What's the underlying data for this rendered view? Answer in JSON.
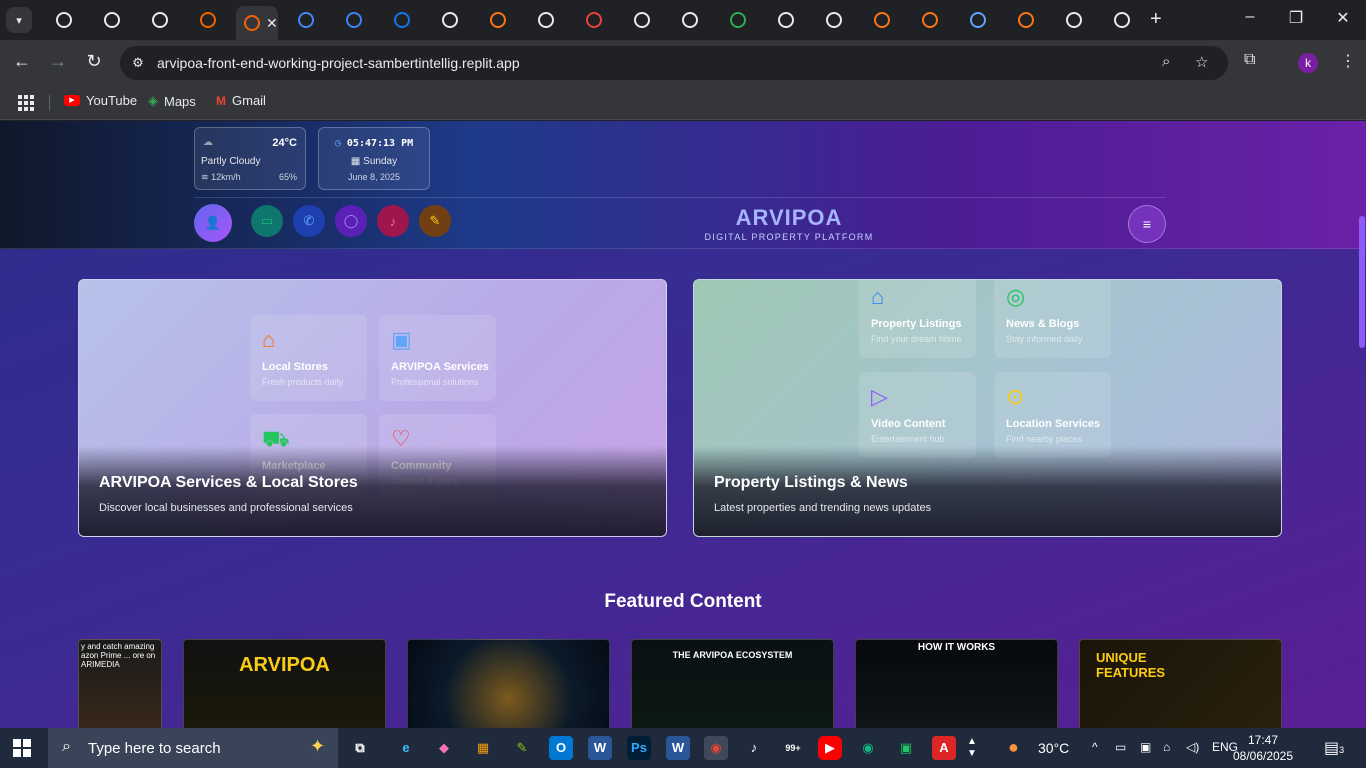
{
  "browser": {
    "tabs": [
      {
        "icon": "chatgpt-icon",
        "color": "#e8eaed"
      },
      {
        "icon": "openai-icon",
        "color": "#e8eaed"
      },
      {
        "icon": "openai-icon",
        "color": "#e8eaed"
      },
      {
        "icon": "replit-icon",
        "color": "#f26207"
      },
      {
        "icon": "replit-icon",
        "color": "#f26207",
        "active": true
      },
      {
        "icon": "google-icon",
        "color": "#4285f4"
      },
      {
        "icon": "cart-icon",
        "color": "#3b82f6"
      },
      {
        "icon": "globe-icon",
        "color": "#1a73e8"
      },
      {
        "icon": "openai-icon",
        "color": "#e8eaed"
      },
      {
        "icon": "fire-icon",
        "color": "#f97316"
      },
      {
        "icon": "r-icon",
        "color": "#e8eaed"
      },
      {
        "icon": "gmail-icon",
        "color": "#ea4335"
      },
      {
        "icon": "settings-icon",
        "color": "#e8eaed"
      },
      {
        "icon": "perplexity-icon",
        "color": "#e8eaed"
      },
      {
        "icon": "drive-icon",
        "color": "#34a853"
      },
      {
        "icon": "openai-icon",
        "color": "#e8eaed"
      },
      {
        "icon": "google-lens-icon",
        "color": "#e8eaed"
      },
      {
        "icon": "cp-icon",
        "color": "#f97316"
      },
      {
        "icon": "cp-icon",
        "color": "#f97316"
      },
      {
        "icon": "gemini-icon",
        "color": "#60a5fa"
      },
      {
        "icon": "cp-icon",
        "color": "#f97316"
      },
      {
        "icon": "copilot-icon",
        "color": "#e8eaed"
      },
      {
        "icon": "github-icon",
        "color": "#e8eaed"
      }
    ],
    "url": "arvipoa-front-end-working-project-sambertintellig.replit.app",
    "profile_initial": "k",
    "bookmarks": [
      {
        "label": "YouTube",
        "icon": "youtube-icon",
        "color": "#ff0000"
      },
      {
        "label": "Maps",
        "icon": "maps-icon",
        "color": "#34a853"
      },
      {
        "label": "Gmail",
        "icon": "gmail-icon",
        "color": "#ea4335"
      }
    ]
  },
  "site": {
    "weather": {
      "temp": "24°C",
      "condition": "Partly Cloudy",
      "wind": "12km/h",
      "humidity": "65%"
    },
    "clock": {
      "time": "05:47:13 PM",
      "day": "Sunday",
      "date": "June 8, 2025"
    },
    "brand": {
      "name": "ARVIPOA",
      "tagline": "DIGITAL PROPERTY PLATFORM"
    },
    "header_buttons": [
      {
        "name": "video-icon",
        "color": "#10b981",
        "bg": "#0f766e"
      },
      {
        "name": "phone-icon",
        "color": "#60a5fa",
        "bg": "#1e40af"
      },
      {
        "name": "chat-icon",
        "color": "#a78bfa",
        "bg": "#5b21b6"
      },
      {
        "name": "bell-icon",
        "color": "#f472b6",
        "bg": "#9d174d"
      },
      {
        "name": "pencil-icon",
        "color": "#facc15",
        "bg": "#713f12"
      }
    ],
    "cards": [
      {
        "title": "ARVIPOA Services & Local Stores",
        "description": "Discover local businesses and professional services",
        "tiles": [
          {
            "title": "Local Stores",
            "subtitle": "Fresh products daily",
            "icon": "store-icon",
            "color": "#f97316"
          },
          {
            "title": "ARVIPOA Services",
            "subtitle": "Professional solutions",
            "icon": "briefcase-icon",
            "color": "#60a5fa"
          },
          {
            "title": "Marketplace",
            "subtitle": "",
            "icon": "cart-icon",
            "color": "#22c55e"
          },
          {
            "title": "Community",
            "subtitle": "Connect & share",
            "icon": "heart-icon",
            "color": "#ef4444"
          }
        ]
      },
      {
        "title": "Property Listings & News",
        "description": "Latest properties and trending news updates",
        "tiles": [
          {
            "title": "Property Listings",
            "subtitle": "Find your dream home",
            "icon": "home-icon",
            "color": "#3b82f6"
          },
          {
            "title": "News & Blogs",
            "subtitle": "Stay informed daily",
            "icon": "globe-icon",
            "color": "#22c55e"
          },
          {
            "title": "Video Content",
            "subtitle": "Entertainment hub",
            "icon": "play-icon",
            "color": "#8b5cf6"
          },
          {
            "title": "Location Services",
            "subtitle": "Find nearby places",
            "icon": "location-pin-icon",
            "color": "#facc15"
          }
        ]
      }
    ],
    "featured": {
      "title": "Featured Content",
      "thumbs": [
        {
          "text": "y and catch amazing azon Prime ... ore on ARIMEDIA"
        },
        {
          "text": "ARVIPOA"
        },
        {
          "text": ""
        },
        {
          "text": "THE ARVIPOA ECOSYSTEM"
        },
        {
          "text": "HOW IT WORKS"
        },
        {
          "text": "UNIQUE FEATURES"
        }
      ]
    }
  },
  "taskbar": {
    "search_placeholder": "Type here to search",
    "weather": "30°C",
    "language": "ENG",
    "time": "17:47",
    "date": "08/06/2025",
    "notifications": "3"
  }
}
